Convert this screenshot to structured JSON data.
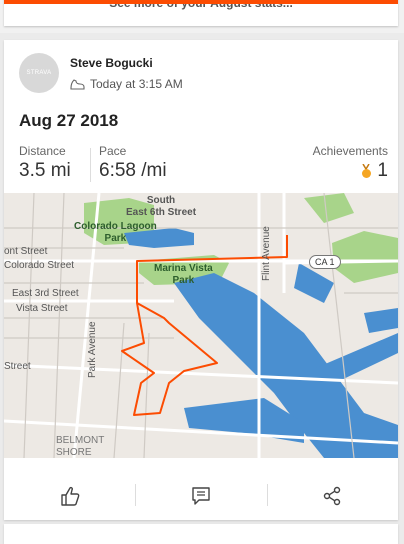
{
  "top_card": {
    "stats_link": "See more of your August stats..."
  },
  "activity": {
    "avatar_text": "STRAVA",
    "athlete_name": "Steve Bogucki",
    "timestamp": "Today at 3:15 AM",
    "title": "Aug 27 2018",
    "stats": [
      {
        "label": "Distance",
        "value": "3.5 mi"
      },
      {
        "label": "Pace",
        "value": "6:58 /mi"
      }
    ],
    "achievements": {
      "label": "Achievements",
      "value": "1",
      "medal_color": "#f5a623"
    }
  },
  "map": {
    "labels": {
      "south_e6": "South\nEast 6th Street",
      "colorado_lagoon": "Colorado Lagoon\nPark",
      "marina_vista": "Marina Vista\nPark",
      "flint_ave": "Flint Avenue",
      "ont_street": "ont Street",
      "colorado_street": "Colorado Street",
      "east_3rd": "East 3rd Street",
      "vista_street": "Vista Street",
      "park_avenue": "Park Avenue",
      "street": "Street",
      "belmont": "BELMONT\nSHORE",
      "ca1": "CA 1"
    },
    "route_color": "#fc4c02",
    "water_color": "#4a8fd0",
    "park_color": "#a8d48a"
  },
  "actions": [
    {
      "name": "kudos-button",
      "icon": "thumbs-up-icon"
    },
    {
      "name": "comment-button",
      "icon": "comment-icon"
    },
    {
      "name": "share-button",
      "icon": "share-icon"
    }
  ],
  "theme": {
    "accent": "#fc4c02"
  }
}
